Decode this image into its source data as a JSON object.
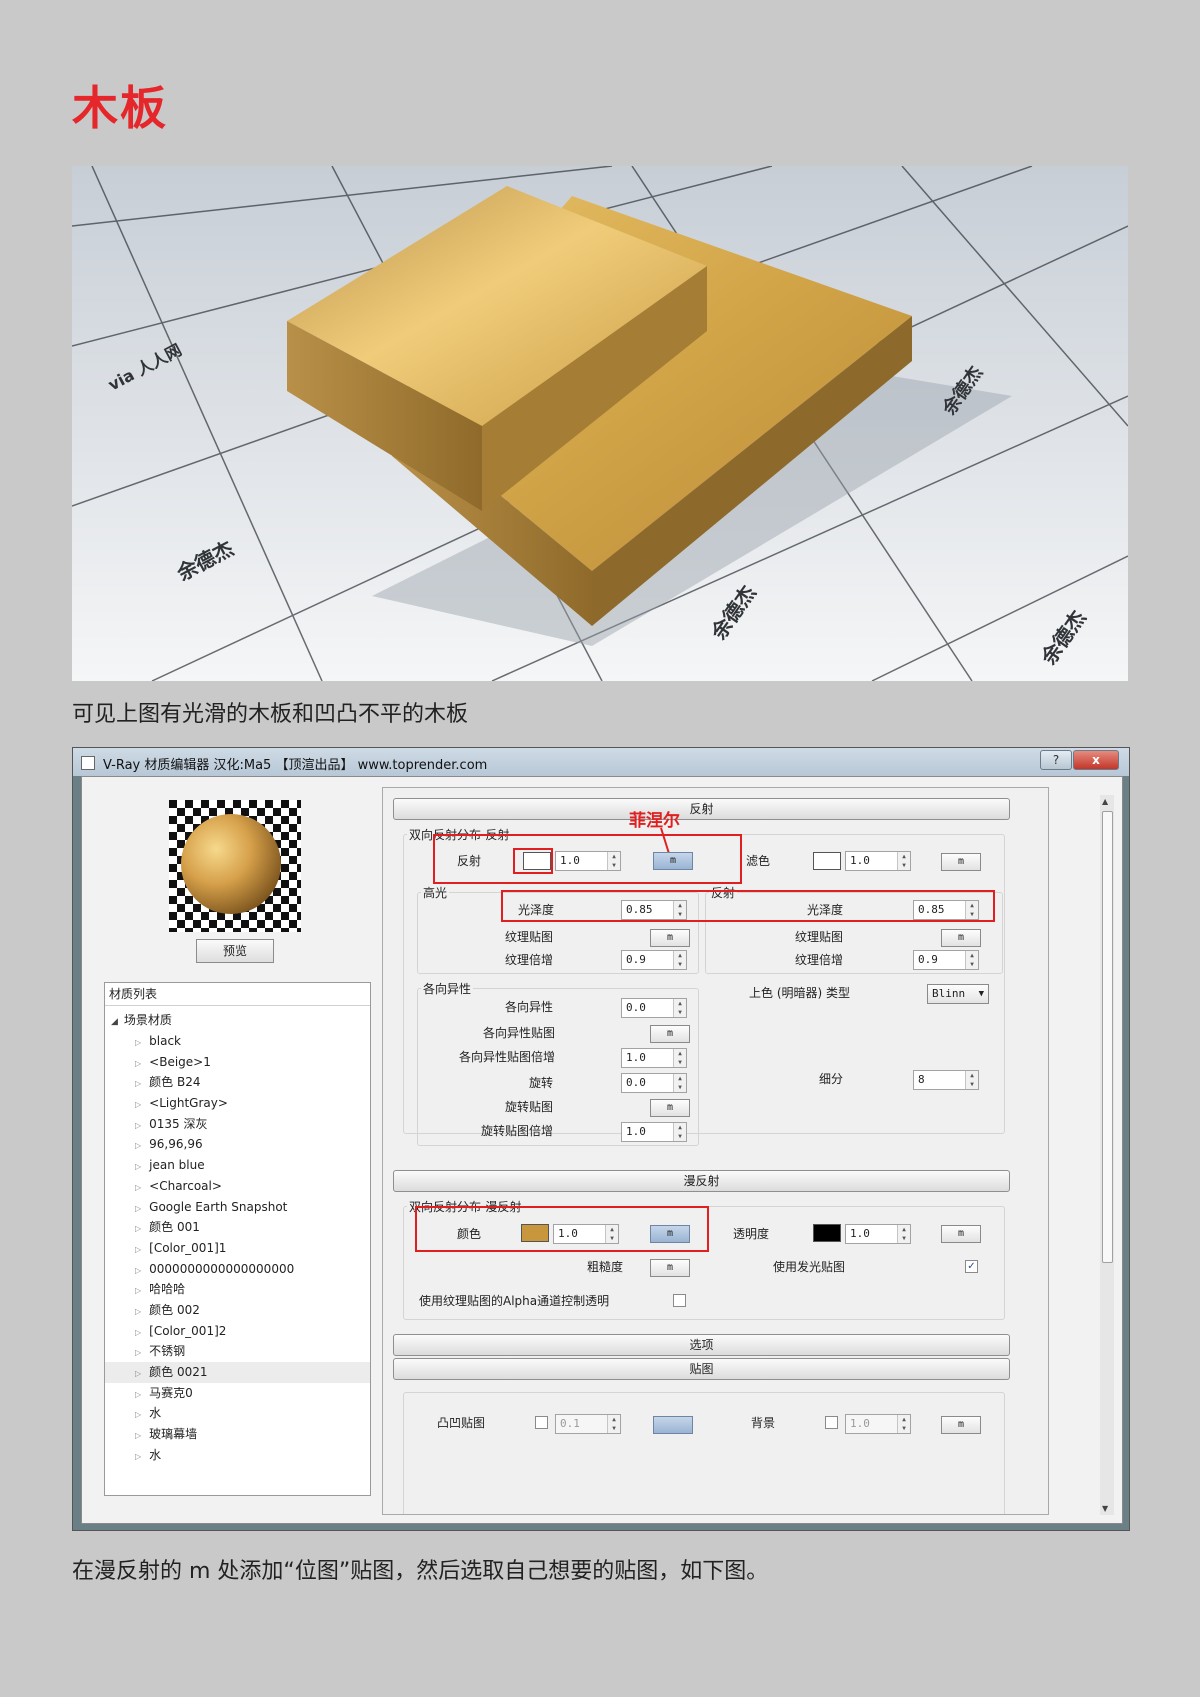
{
  "page": {
    "title": "木板",
    "caption_top": "可见上图有光滑的木板和凹凸不平的木板",
    "caption_bottom": "在漫反射的 m 处添加“位图”贴图，然后选取自己想要的贴图，如下图。"
  },
  "render_watermark": {
    "text": "余德杰",
    "logo": "via 人人网"
  },
  "window": {
    "title": "V-Ray 材质编辑器    汉化:Ma5    【顶渲出品】 www.toprender.com",
    "help_label": "?",
    "close_label": "x"
  },
  "left": {
    "preview_button": "预览",
    "material_list_header": "材质列表",
    "tree_root": "场景材质",
    "materials": [
      "black",
      "<Beige>1",
      "颜色 B24",
      "<LightGray>",
      "0135 深灰",
      "96,96,96",
      "jean blue",
      "<Charcoal>",
      "Google Earth Snapshot",
      "颜色 001",
      "[Color_001]1",
      "0000000000000000000",
      "哈哈哈",
      "颜色 002",
      "[Color_001]2",
      "不锈钢",
      "颜色 0021",
      "马赛克0",
      "水",
      "玻璃幕墙",
      "水"
    ],
    "selected_material": "颜色 0021"
  },
  "annotation": {
    "text": "菲涅尔"
  },
  "reflection": {
    "rollout": "反射",
    "group_brdf": "双向反射分布-反射",
    "reflect_label": "反射",
    "reflect_value": "1.0",
    "reflect_swatch": "#ffffff",
    "filter_label": "滤色",
    "filter_value": "1.0",
    "filter_swatch": "#ffffff",
    "highlight_group": "高光",
    "reflect_group": "反射",
    "gloss_label": "光泽度",
    "hl_gloss_value": "0.85",
    "rf_gloss_value": "0.85",
    "tex_map_label": "纹理贴图",
    "tex_mult_label": "纹理倍增",
    "hl_tex_mult_value": "0.9",
    "rf_tex_mult_value": "0.9",
    "aniso_group": "各向异性",
    "aniso_label": "各向异性",
    "aniso_value": "0.0",
    "aniso_map_label": "各向异性贴图",
    "aniso_map_mult_label": "各向异性贴图倍增",
    "aniso_map_mult_value": "1.0",
    "rotation_label": "旋转",
    "rotation_value": "0.0",
    "rotation_map_label": "旋转贴图",
    "rotation_map_mult_label": "旋转贴图倍增",
    "rotation_map_mult_value": "1.0",
    "shader_type_label": "上色 (明暗器) 类型",
    "shader_type_value": "Blinn",
    "subdivs_label": "细分",
    "subdivs_value": "8",
    "m_label": "m"
  },
  "diffuse": {
    "rollout": "漫反射",
    "group_brdf": "双向反射分布-漫反射",
    "color_label": "颜色",
    "color_value": "1.0",
    "color_swatch": "#c8963c",
    "transparency_label": "透明度",
    "transparency_value": "1.0",
    "transparency_swatch": "#000000",
    "roughness_label": "粗糙度",
    "emissive_label": "使用发光贴图",
    "emissive_checked": "✓",
    "alpha_label": "使用纹理贴图的Alpha通道控制透明"
  },
  "options": {
    "rollout": "选项"
  },
  "maps": {
    "rollout": "贴图",
    "bump_label": "凸凹贴图",
    "bump_value": "0.1",
    "background_label": "背景",
    "background_value": "1.0"
  }
}
